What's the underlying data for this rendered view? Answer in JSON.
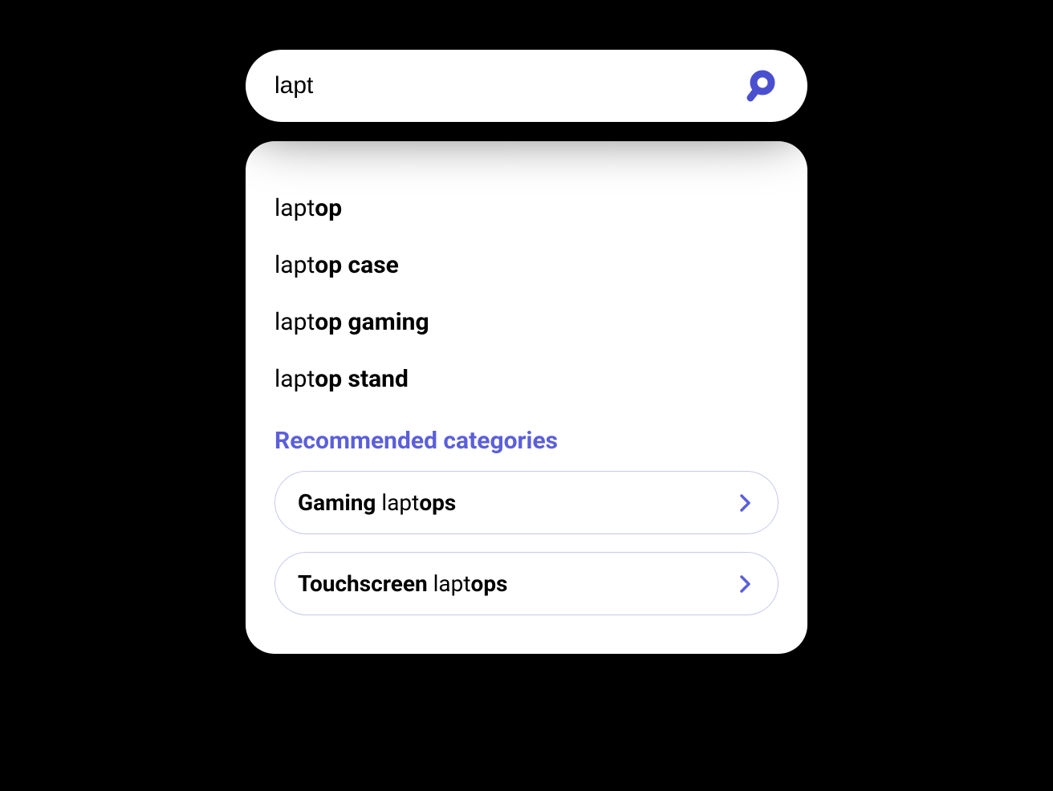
{
  "search": {
    "query": "lapt"
  },
  "suggestions": [
    {
      "match": "lapt",
      "rest": "op"
    },
    {
      "match": "lapt",
      "rest": "op case"
    },
    {
      "match": "lapt",
      "rest": "op gaming"
    },
    {
      "match": "lapt",
      "rest": "op stand"
    }
  ],
  "recommended": {
    "title": "Recommended categories",
    "categories": [
      {
        "pre": "Gaming ",
        "match": "lapt",
        "post": "ops"
      },
      {
        "pre": "Touchscreen ",
        "match": "lapt",
        "post": "ops"
      }
    ]
  },
  "colors": {
    "accent": "#5b5fd9"
  }
}
